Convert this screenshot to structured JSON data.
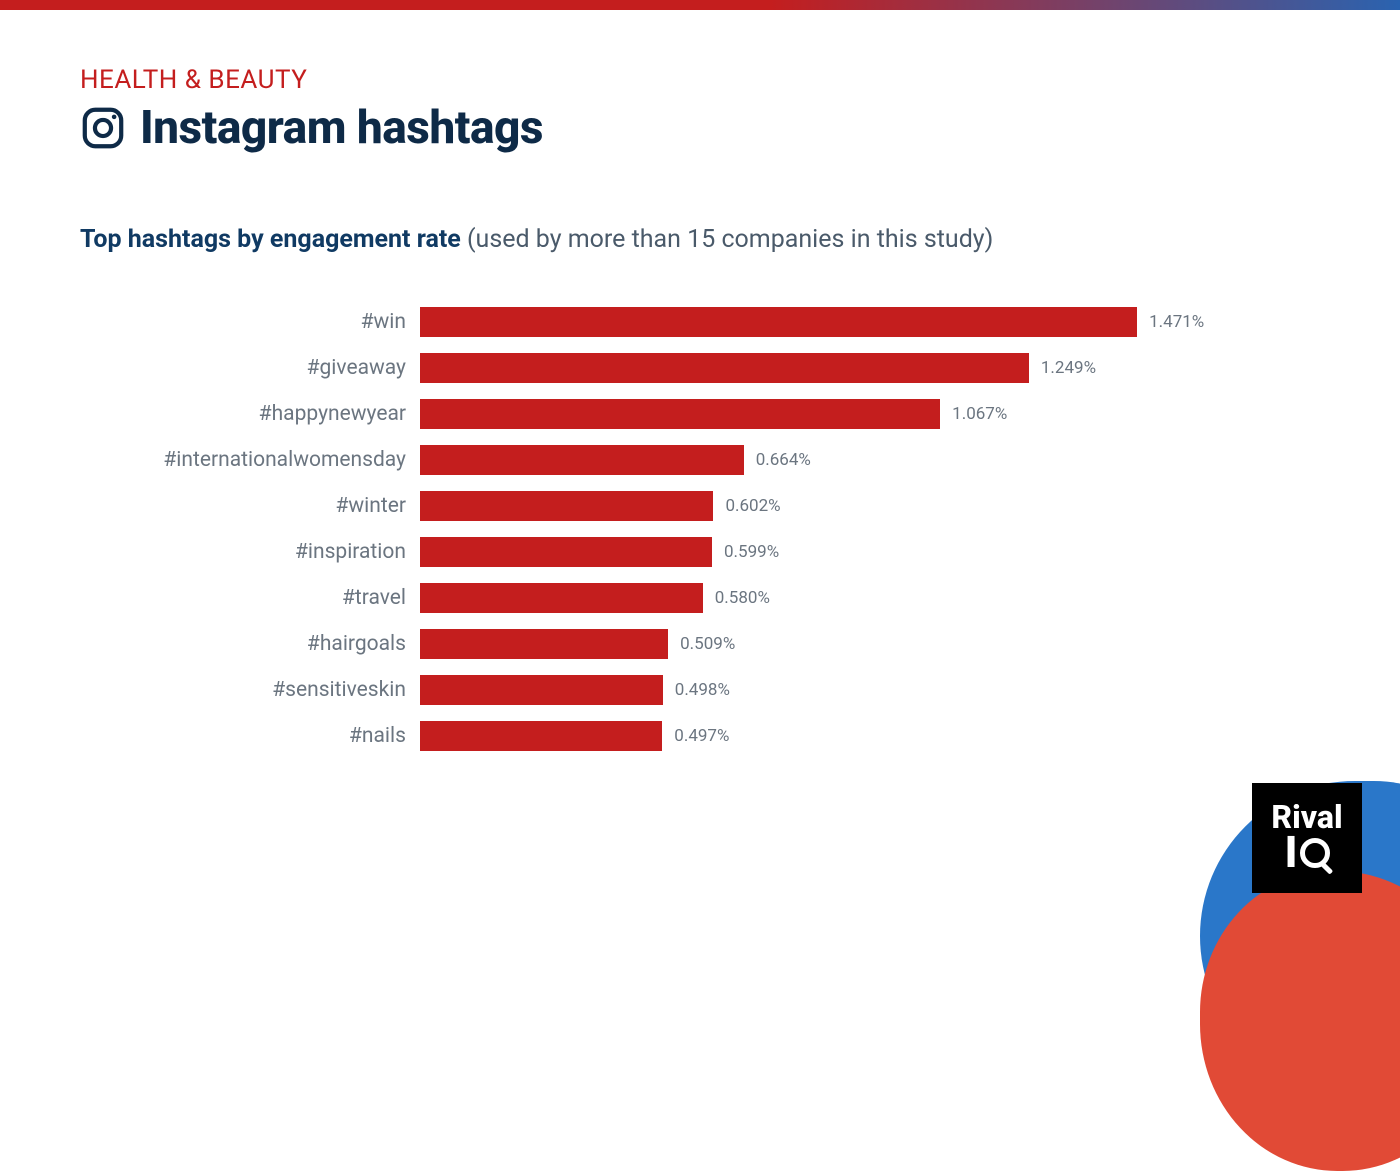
{
  "header": {
    "eyebrow": "HEALTH & BEAUTY",
    "title": "Instagram hashtags",
    "subtitle_bold": "Top hashtags by engagement rate",
    "subtitle_rest": " (used by more than 15 companies in this study)"
  },
  "logo": {
    "line1": "Rival",
    "line2": "I"
  },
  "colors": {
    "bar": "#c41e1e",
    "accent_blue": "#2a77c9"
  },
  "chart_data": {
    "type": "bar",
    "orientation": "horizontal",
    "title": "Top hashtags by engagement rate",
    "xlabel": "",
    "ylabel": "",
    "xlim": [
      0,
      1.6
    ],
    "value_format": "percent_3dp",
    "categories": [
      "#win",
      "#giveaway",
      "#happynewyear",
      "#internationalwomensday",
      "#winter",
      "#inspiration",
      "#travel",
      "#hairgoals",
      "#sensitiveskin",
      "#nails"
    ],
    "values": [
      1.471,
      1.249,
      1.067,
      0.664,
      0.602,
      0.599,
      0.58,
      0.509,
      0.498,
      0.497
    ],
    "value_labels": [
      "1.471%",
      "1.249%",
      "1.067%",
      "0.664%",
      "0.602%",
      "0.599%",
      "0.580%",
      "0.509%",
      "0.498%",
      "0.497%"
    ]
  }
}
